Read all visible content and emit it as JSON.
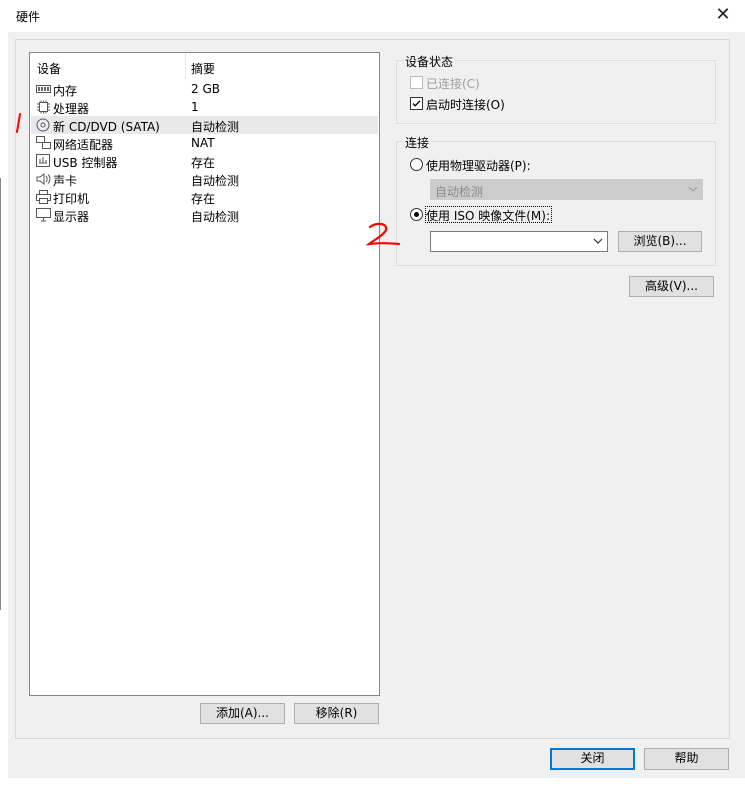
{
  "window": {
    "title": "硬件",
    "close_glyph": "✕"
  },
  "device_list": {
    "headers": {
      "device": "设备",
      "summary": "摘要"
    },
    "items": [
      {
        "name": "内存",
        "summary": "2 GB",
        "icon": "memory-icon"
      },
      {
        "name": "处理器",
        "summary": "1",
        "icon": "cpu-icon"
      },
      {
        "name": "新 CD/DVD (SATA)",
        "summary": "自动检测",
        "icon": "cd-dvd-icon",
        "selected": true
      },
      {
        "name": "网络适配器",
        "summary": "NAT",
        "icon": "network-adapter-icon"
      },
      {
        "name": "USB 控制器",
        "summary": "存在",
        "icon": "usb-controller-icon"
      },
      {
        "name": "声卡",
        "summary": "自动检测",
        "icon": "sound-card-icon"
      },
      {
        "name": "打印机",
        "summary": "存在",
        "icon": "printer-icon"
      },
      {
        "name": "显示器",
        "summary": "自动检测",
        "icon": "display-icon"
      }
    ],
    "add_button": "添加(A)...",
    "remove_button": "移除(R)"
  },
  "device_status": {
    "title": "设备状态",
    "connected": {
      "label": "已连接(C)",
      "checked": false,
      "enabled": false
    },
    "connect_at_power_on": {
      "label": "启动时连接(O)",
      "checked": true
    }
  },
  "connection": {
    "title": "连接",
    "physical_drive": {
      "label": "使用物理驱动器(P):",
      "selected": false,
      "combo_value": "自动检测"
    },
    "iso_image": {
      "label": "使用 ISO 映像文件(M):",
      "selected": true,
      "path_value": "",
      "browse_button": "浏览(B)..."
    }
  },
  "advanced_button": "高级(V)...",
  "footer": {
    "close_button": "关闭",
    "help_button": "帮助"
  },
  "annotations": {
    "marker_1": "1",
    "marker_2": "2",
    "marker_color": "#ff0000"
  }
}
